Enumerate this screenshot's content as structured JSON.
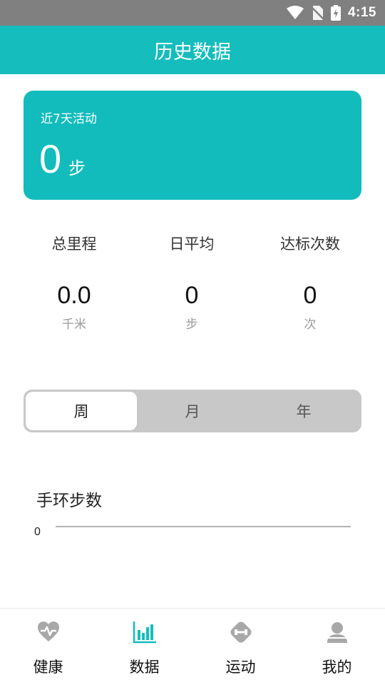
{
  "status_bar": {
    "time": "4:15"
  },
  "header": {
    "title": "历史数据"
  },
  "summary": {
    "label": "近7天活动",
    "value": "0",
    "unit": "步"
  },
  "stats": [
    {
      "label": "总里程",
      "value": "0.0",
      "unit": "千米"
    },
    {
      "label": "日平均",
      "value": "0",
      "unit": "步"
    },
    {
      "label": "达标次数",
      "value": "0",
      "unit": "次"
    }
  ],
  "segment": {
    "options": [
      "周",
      "月",
      "年"
    ],
    "selected": "周"
  },
  "chart_data": {
    "type": "line",
    "title": "手环步数",
    "y_ticks": [
      "0"
    ],
    "series": [],
    "ylim": [
      0,
      0
    ]
  },
  "nav": {
    "items": [
      {
        "label": "健康",
        "icon": "heart-pulse-icon"
      },
      {
        "label": "数据",
        "icon": "bar-chart-icon",
        "active": true
      },
      {
        "label": "运动",
        "icon": "dumbbell-icon"
      },
      {
        "label": "我的",
        "icon": "user-icon"
      }
    ]
  },
  "colors": {
    "accent": "#15bdbd",
    "status_bar": "#808080",
    "icon_gray": "#a8a8a8"
  }
}
